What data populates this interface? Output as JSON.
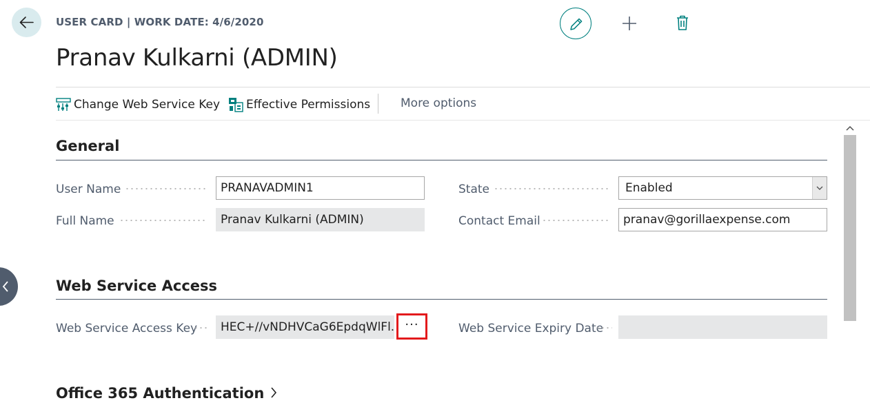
{
  "header": {
    "caption": "USER CARD | WORK DATE: 4/6/2020",
    "title": "Pranav Kulkarni (ADMIN)",
    "icons": {
      "back": "arrow-left-icon",
      "edit": "pencil-icon",
      "add": "plus-icon",
      "delete": "trash-icon"
    }
  },
  "actions": {
    "change_key_label": "Change Web Service Key",
    "change_key_icon": "key-settings-icon",
    "effective_permissions_label": "Effective Permissions",
    "effective_permissions_icon": "permissions-icon",
    "more_options_label": "More options"
  },
  "general": {
    "title": "General",
    "user_name_label": "User Name",
    "user_name_value": "PRANAVADMIN1",
    "full_name_label": "Full Name",
    "full_name_value": "Pranav Kulkarni (ADMIN)",
    "state_label": "State",
    "state_value": "Enabled",
    "contact_email_label": "Contact Email",
    "contact_email_value": "pranav@gorillaexpense.com"
  },
  "web_service": {
    "title": "Web Service Access",
    "access_key_label": "Web Service Access Key",
    "access_key_value": "HEC+//vNDHVCaG6EpdqWlFl...",
    "assist_button_label": "···",
    "expiry_date_label": "Web Service Expiry Date",
    "expiry_date_value": ""
  },
  "office365": {
    "title": "Office 365 Authentication"
  },
  "colors": {
    "accent": "#00807f",
    "highlight_border": "#e31a1c",
    "label_text": "#505c6d"
  }
}
